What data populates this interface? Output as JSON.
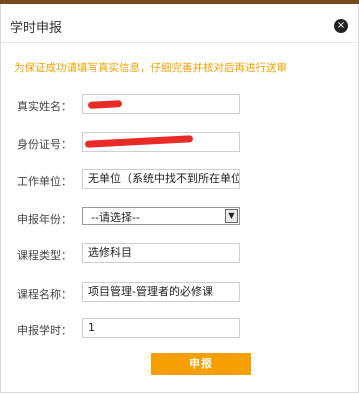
{
  "dialog": {
    "title": "学时申报",
    "close_icon": "×"
  },
  "notice": "为保证成功请填写真实信息，仔细完善并核对后再进行送审",
  "form": {
    "name": {
      "label": "真实姓名：",
      "value": ""
    },
    "id_number": {
      "label": "身份证号：",
      "value": ""
    },
    "work_unit": {
      "label": "工作单位：",
      "value": "无单位（系统中找不到所在单位"
    },
    "year": {
      "label": "申报年份：",
      "selected": "--请选择--"
    },
    "course_type": {
      "label": "课程类型：",
      "value": "选修科目"
    },
    "course_name": {
      "label": "课程名称：",
      "value": "项目管理-管理者的必修课"
    },
    "hours": {
      "label": "申报学时：",
      "value": "1"
    }
  },
  "submit_label": "申报",
  "colors": {
    "accent": "#f5a000",
    "notice": "#f0a000",
    "topbar": "#7a4a1c",
    "redaction": "#e8201c"
  }
}
